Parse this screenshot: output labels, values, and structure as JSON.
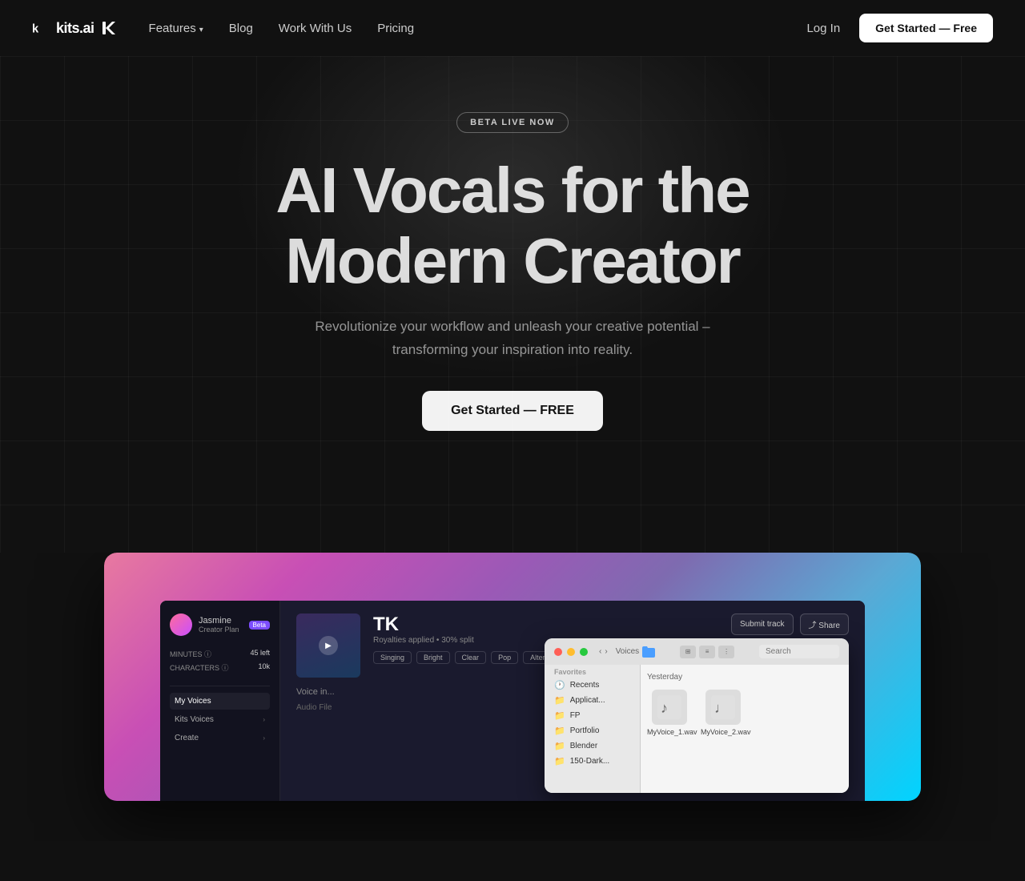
{
  "nav": {
    "logo_text": "kits.ai",
    "features_label": "Features",
    "blog_label": "Blog",
    "work_with_us_label": "Work With Us",
    "pricing_label": "Pricing",
    "login_label": "Log In",
    "cta_label": "Get Started — Free"
  },
  "hero": {
    "badge_label": "BETA LIVE NOW",
    "title_line1": "AI Vocals for the",
    "title_line2": "Modern Creator",
    "subtitle": "Revolutionize your workflow and unleash your creative potential – transforming your inspiration into reality.",
    "cta_label": "Get Started — FREE"
  },
  "app_preview": {
    "sidebar": {
      "username": "Jasmine",
      "plan": "Creator Plan",
      "badge": "Beta",
      "stats": [
        {
          "label": "MINUTES",
          "value": "45 left"
        },
        {
          "label": "CHARACTERS",
          "value": "10k"
        }
      ],
      "menu_items": [
        {
          "label": "My Voices",
          "has_arrow": false
        },
        {
          "label": "Kits Voices",
          "has_arrow": true
        },
        {
          "label": "Create",
          "has_arrow": true
        }
      ]
    },
    "track": {
      "title": "TK",
      "royalty": "Royalties applied • 30% split",
      "tags": [
        "Singing",
        "Bright",
        "Clear",
        "Pop",
        "Alternative"
      ],
      "actions": [
        "Submit track",
        "Share"
      ],
      "voice_label": "Voice in..."
    },
    "file_picker": {
      "section_label": "Voices",
      "date_label": "Yesterday",
      "files": [
        {
          "name": "MyVoice_1.wav",
          "icon": "🎵"
        },
        {
          "name": "MyVoice_2.wav",
          "icon": "🎵"
        }
      ],
      "sidebar_items": [
        {
          "label": "Recents",
          "active": false
        },
        {
          "label": "Application...",
          "active": false
        },
        {
          "label": "FP",
          "active": false
        },
        {
          "label": "Portfolio",
          "active": false
        },
        {
          "label": "Blender",
          "active": false
        },
        {
          "label": "150-Dark...",
          "active": false
        }
      ],
      "search_placeholder": "Search",
      "audio_file_label": "Audio File"
    }
  }
}
